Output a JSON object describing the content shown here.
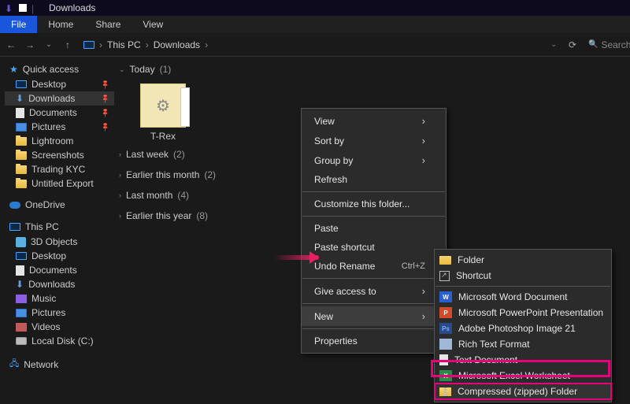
{
  "title": "Downloads",
  "ribbon": {
    "file": "File",
    "home": "Home",
    "share": "Share",
    "view": "View"
  },
  "breadcrumbs": {
    "root": "This PC",
    "current": "Downloads"
  },
  "search": {
    "placeholder": "Search"
  },
  "sidebar": {
    "quickAccess": {
      "label": "Quick access",
      "items": [
        "Desktop",
        "Downloads",
        "Documents",
        "Pictures",
        "Lightroom",
        "Screenshots",
        "Trading KYC",
        "Untitled Export"
      ]
    },
    "onedrive": "OneDrive",
    "thisPc": {
      "label": "This PC",
      "items": [
        "3D Objects",
        "Desktop",
        "Documents",
        "Downloads",
        "Music",
        "Pictures",
        "Videos",
        "Local Disk (C:)"
      ]
    },
    "network": "Network"
  },
  "groups": {
    "today": {
      "label": "Today",
      "count": "(1)"
    },
    "lastWeek": {
      "label": "Last week",
      "count": "(2)"
    },
    "earlierMonth": {
      "label": "Earlier this month",
      "count": "(2)"
    },
    "lastMonth": {
      "label": "Last month",
      "count": "(4)"
    },
    "earlierYear": {
      "label": "Earlier this year",
      "count": "(8)"
    }
  },
  "items": {
    "trex": "T-Rex"
  },
  "ctx": {
    "view": "View",
    "sortBy": "Sort by",
    "groupBy": "Group by",
    "refresh": "Refresh",
    "customize": "Customize this folder...",
    "paste": "Paste",
    "pasteShortcut": "Paste shortcut",
    "undoRename": "Undo Rename",
    "undoKey": "Ctrl+Z",
    "giveAccess": "Give access to",
    "new": "New",
    "properties": "Properties"
  },
  "newMenu": {
    "folder": "Folder",
    "shortcut": "Shortcut",
    "word": "Microsoft Word Document",
    "ppt": "Microsoft PowerPoint Presentation",
    "ps": "Adobe Photoshop Image 21",
    "rtf": "Rich Text Format",
    "txt": "Text Document",
    "xls": "Microsoft Excel Worksheet",
    "zip": "Compressed (zipped) Folder"
  }
}
